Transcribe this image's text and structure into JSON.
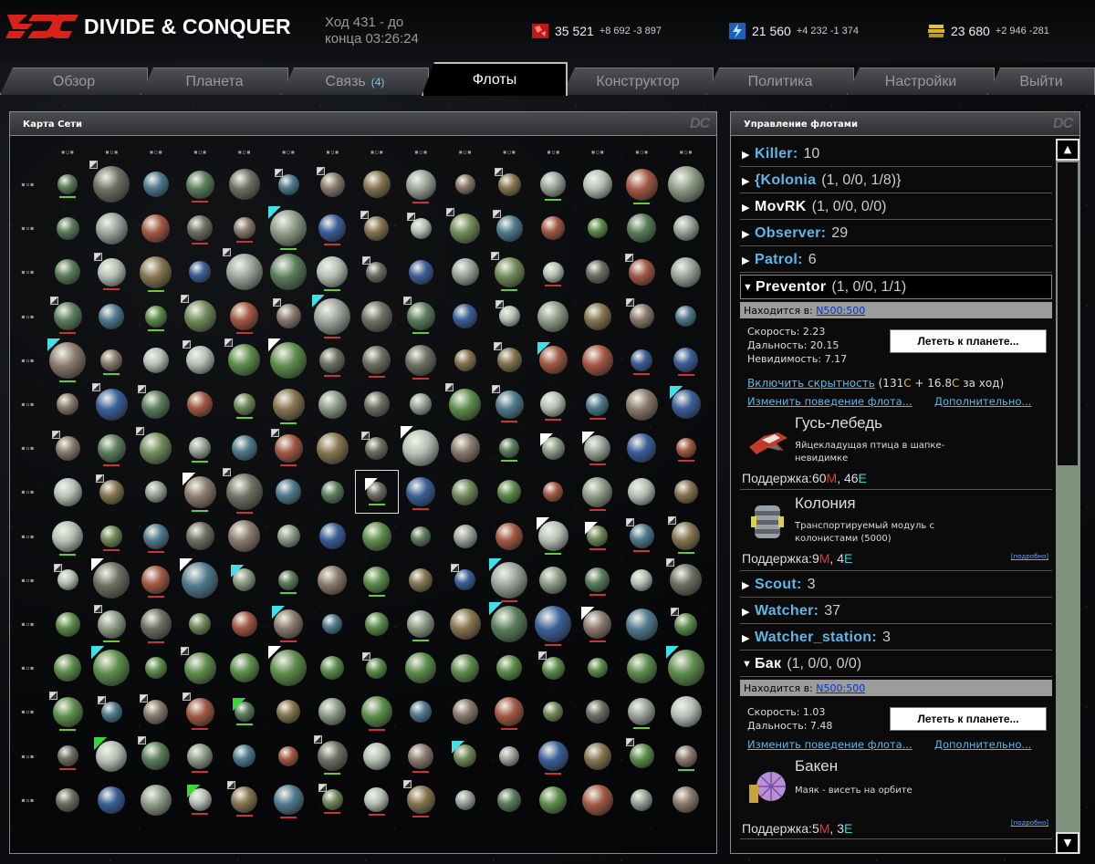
{
  "header": {
    "logo_text": "DIVIDE & CONQUER",
    "turn_line1": "Ход 431 - до",
    "turn_line2": "конца 03:26:24",
    "resources": [
      {
        "icon": "red-crystal-icon",
        "value": "35 521",
        "delta": "+8 692 -3 897",
        "color": "#d11"
      },
      {
        "icon": "blue-energy-icon",
        "value": "21 560",
        "delta": "+4 232 -1 374",
        "color": "#2a7fd8"
      },
      {
        "icon": "gold-credits-icon",
        "value": "23 680",
        "delta": "+2 946 -281",
        "color": "#d6b21c"
      }
    ]
  },
  "tabs": [
    {
      "label": "Обзор",
      "count": ""
    },
    {
      "label": "Планета",
      "count": ""
    },
    {
      "label": "Связь",
      "count": "(4)"
    },
    {
      "label": "Флоты",
      "count": "",
      "active": true
    },
    {
      "label": "Конструктор",
      "count": ""
    },
    {
      "label": "Политика",
      "count": ""
    },
    {
      "label": "Настройки",
      "count": ""
    },
    {
      "label": "Выйти",
      "count": ""
    }
  ],
  "map": {
    "title": "Карта Сети",
    "cols": 15,
    "rows": 15,
    "palette": [
      "#5a7d5c",
      "#708a5a",
      "#8d9b86",
      "#9aa39a",
      "#4f7a8e",
      "#3b5f99",
      "#a35844",
      "#85744f",
      "#6d6f62",
      "#5d8d4c",
      "#b6bfb5",
      "#8a7a6c"
    ],
    "big_planets": [
      [
        0,
        1
      ],
      [
        0,
        14
      ],
      [
        1,
        5
      ],
      [
        2,
        4
      ],
      [
        2,
        5
      ],
      [
        3,
        6
      ],
      [
        4,
        0
      ],
      [
        4,
        5
      ],
      [
        6,
        8
      ],
      [
        7,
        4
      ],
      [
        9,
        1
      ],
      [
        9,
        3
      ],
      [
        9,
        10
      ],
      [
        10,
        10
      ],
      [
        10,
        11
      ],
      [
        11,
        1
      ],
      [
        11,
        5
      ],
      [
        11,
        14
      ]
    ],
    "cyan_marks": [
      [
        1,
        5
      ],
      [
        3,
        6
      ],
      [
        4,
        0
      ],
      [
        4,
        11
      ],
      [
        5,
        14
      ],
      [
        9,
        4
      ],
      [
        9,
        10
      ],
      [
        10,
        5
      ],
      [
        10,
        10
      ],
      [
        11,
        1
      ],
      [
        11,
        14
      ],
      [
        13,
        9
      ]
    ],
    "green_marks": [
      [
        12,
        4
      ],
      [
        13,
        1
      ],
      [
        14,
        3
      ]
    ],
    "white_marks": [
      [
        4,
        5
      ],
      [
        6,
        8
      ],
      [
        6,
        11
      ],
      [
        6,
        12
      ],
      [
        7,
        3
      ],
      [
        7,
        7
      ],
      [
        8,
        11
      ],
      [
        8,
        12
      ],
      [
        9,
        1
      ],
      [
        9,
        3
      ],
      [
        10,
        12
      ],
      [
        11,
        5
      ]
    ],
    "selected": [
      7,
      7
    ]
  },
  "fleets": {
    "title": "Управление флотами",
    "rows": [
      {
        "name": "Killer:",
        "value": "10",
        "style": "blue"
      },
      {
        "name": "{Kolonia",
        "value": "(1, 0/0, 1/8)}",
        "style": "blue"
      },
      {
        "name": "MovRK",
        "value": "(1, 0/0, 0/0)",
        "style": "white"
      },
      {
        "name": "Observer:",
        "value": "29",
        "style": "blue"
      },
      {
        "name": "Patrol:",
        "value": "6",
        "style": "blue"
      }
    ],
    "preventor": {
      "name": "Preventor",
      "value": "(1, 0/0, 1/1)",
      "location_label": "Находится в:",
      "location": "N500:500",
      "speed": "Скорость: 2.23",
      "range": "Дальность: 20.15",
      "stealth": "Невидимость: 7.17",
      "fly_button": "Лететь к планете...",
      "cloak_link": "Включить скрытность",
      "cloak_cost_a": "(131",
      "cloak_cost_b": " + 16.8",
      "cloak_cost_c": " за ход)",
      "cost_c": "C",
      "behaviour_link": "Изменить поведение флота...",
      "more_link": "Дополнительно...",
      "ships": [
        {
          "name": "Гусь-лебедь",
          "desc": "Яйцекладущая птица в шапке-невидимке",
          "support": "Поддержка:",
          "m": "60",
          "e": "46",
          "m_unit": "M",
          "e_unit": "E",
          "icon": "bird-ship-icon"
        },
        {
          "name": "Колония",
          "desc": "Транспортируемый модуль с колонистами (5000)",
          "support": "Поддержка:",
          "m": "9",
          "e": "4",
          "m_unit": "M",
          "e_unit": "E",
          "icon": "colony-module-icon",
          "link": "[подробно]"
        }
      ]
    },
    "rows2": [
      {
        "name": "Scout:",
        "value": "3",
        "style": "blue"
      },
      {
        "name": "Watcher:",
        "value": "37",
        "style": "blue"
      },
      {
        "name": "Watcher_station:",
        "value": "3",
        "style": "blue"
      }
    ],
    "bak": {
      "name": "Бак",
      "value": "(1, 0/0, 0/0)",
      "location_label": "Находится в:",
      "location": "N500:500",
      "speed": "Скорость: 1.03",
      "range": "Дальность: 7.48",
      "fly_button": "Лететь к планете...",
      "behaviour_link": "Изменить поведение флота...",
      "more_link": "Дополнительно...",
      "ship": {
        "name": "Бакен",
        "desc": "Маяк - висеть на орбите",
        "support": "Поддержка:",
        "m": "5",
        "e": "3",
        "m_unit": "M",
        "e_unit": "E",
        "icon": "beacon-icon",
        "link": "[подробно]"
      }
    }
  }
}
